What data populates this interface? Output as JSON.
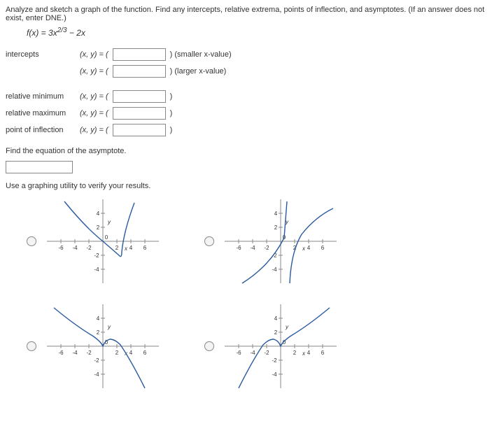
{
  "question": {
    "instruction": "Analyze and sketch a graph of the function. Find any intercepts, relative extrema, points of inflection, and asymptotes. (If an answer does not exist, enter DNE.)",
    "formula_lhs": "f(x)",
    "formula_rhs": "3x",
    "formula_exp": "2/3",
    "formula_tail": " − 2x"
  },
  "rows": {
    "intercepts_label": "intercepts",
    "rel_min_label": "relative minimum",
    "rel_max_label": "relative maximum",
    "poi_label": "point of inflection",
    "xy_prefix": "(x, y) = (",
    "close_paren": ")",
    "smaller_hint": "(smaller x-value)",
    "larger_hint": "(larger x-value)"
  },
  "asymptote": {
    "prompt": "Find the equation of the asymptote."
  },
  "verify": {
    "prompt": "Use a graphing utility to verify your results."
  },
  "chart_data": [
    {
      "type": "line",
      "title": "",
      "xlabel": "x",
      "ylabel": "y",
      "xlim": [
        -7,
        7
      ],
      "ylim": [
        -5,
        5
      ],
      "x_ticks": [
        -6,
        -4,
        -2,
        0,
        2,
        4,
        6
      ],
      "y_ticks": [
        -4,
        -2,
        2,
        4
      ],
      "series": [
        {
          "name": "curve",
          "description": "Curve descending from upper-left, crossing origin, dipping to a local min near x≈2, then rising steeply; not the correct function."
        }
      ]
    },
    {
      "type": "line",
      "title": "",
      "xlabel": "x",
      "ylabel": "y",
      "xlim": [
        -7,
        7
      ],
      "ylim": [
        -5,
        5
      ],
      "x_ticks": [
        -6,
        -4,
        -2,
        0,
        2,
        4,
        6
      ],
      "y_ticks": [
        -4,
        -2,
        2,
        4
      ],
      "series": [
        {
          "name": "curve",
          "description": "Two-branch curve with vertical-asymptote-like behavior near x≈1; left branch coming from lower left up toward asymptote, right branch rising from below to upper right."
        }
      ]
    },
    {
      "type": "line",
      "title": "",
      "xlabel": "x",
      "ylabel": "y",
      "xlim": [
        -7,
        7
      ],
      "ylim": [
        -5,
        5
      ],
      "x_ticks": [
        -6,
        -4,
        -2,
        0,
        2,
        4,
        6
      ],
      "y_ticks": [
        -4,
        -2,
        2,
        4
      ],
      "series": [
        {
          "name": "curve",
          "description": "Curve of 3x^(2/3) − 2x: rises from lower right, local max ≈1 at x=1, cusp local min 0 at x=0, continues up-left with decreasing slope."
        }
      ]
    },
    {
      "type": "line",
      "title": "",
      "xlabel": "x",
      "ylabel": "y",
      "xlim": [
        -7,
        7
      ],
      "ylim": [
        -5,
        5
      ],
      "x_ticks": [
        -6,
        -4,
        -2,
        0,
        2,
        4,
        6
      ],
      "y_ticks": [
        -4,
        -2,
        2,
        4
      ],
      "series": [
        {
          "name": "curve",
          "description": "Mirror of option C about the y-axis."
        }
      ]
    }
  ]
}
